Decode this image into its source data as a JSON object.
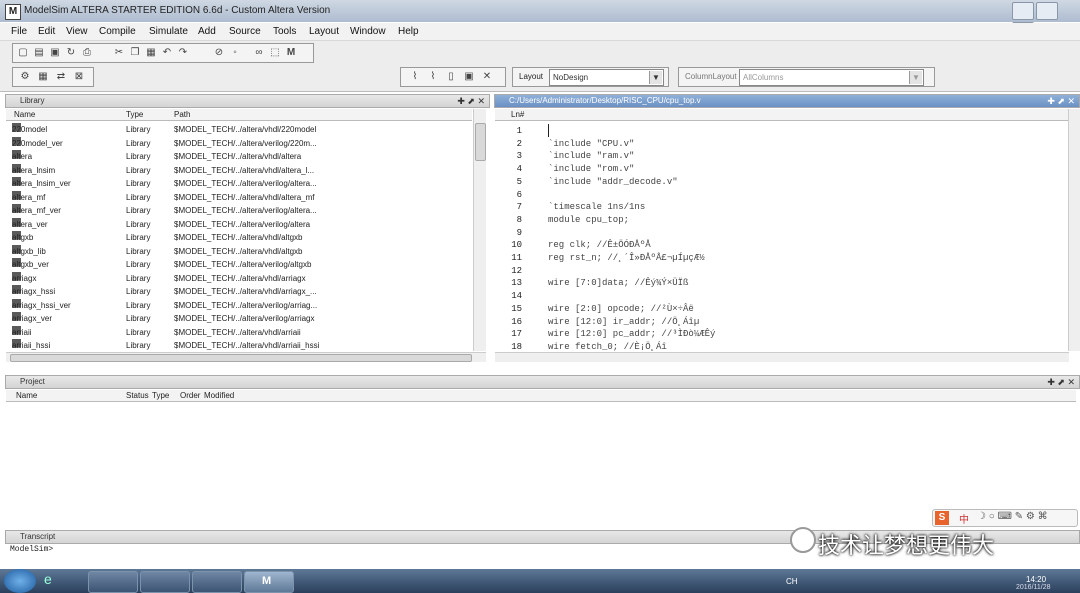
{
  "window": {
    "title": "ModelSim ALTERA STARTER EDITION 6.6d - Custom Altera Version",
    "icon": "M"
  },
  "menu": [
    "File",
    "Edit",
    "View",
    "Compile",
    "Simulate",
    "Add",
    "Source",
    "Tools",
    "Layout",
    "Window",
    "Help"
  ],
  "toolbar": {
    "layout_label": "Layout",
    "layout_value": "NoDesign",
    "column_layout_label": "ColumnLayout",
    "column_layout_value": "AllColumns"
  },
  "library_pane": {
    "title": "Library",
    "columns": [
      "Name",
      "Type",
      "Path"
    ],
    "rows": [
      {
        "name": "220model",
        "type": "Library",
        "path": "$MODEL_TECH/../altera/vhdl/220model"
      },
      {
        "name": "220model_ver",
        "type": "Library",
        "path": "$MODEL_TECH/../altera/verilog/220m..."
      },
      {
        "name": "altera",
        "type": "Library",
        "path": "$MODEL_TECH/../altera/vhdl/altera"
      },
      {
        "name": "altera_lnsim",
        "type": "Library",
        "path": "$MODEL_TECH/../altera/vhdl/altera_l..."
      },
      {
        "name": "altera_lnsim_ver",
        "type": "Library",
        "path": "$MODEL_TECH/../altera/verilog/altera..."
      },
      {
        "name": "altera_mf",
        "type": "Library",
        "path": "$MODEL_TECH/../altera/vhdl/altera_mf"
      },
      {
        "name": "altera_mf_ver",
        "type": "Library",
        "path": "$MODEL_TECH/../altera/verilog/altera..."
      },
      {
        "name": "altera_ver",
        "type": "Library",
        "path": "$MODEL_TECH/../altera/verilog/altera"
      },
      {
        "name": "altgxb",
        "type": "Library",
        "path": "$MODEL_TECH/../altera/vhdl/altgxb"
      },
      {
        "name": "altgxb_lib",
        "type": "Library",
        "path": "$MODEL_TECH/../altera/vhdl/altgxb"
      },
      {
        "name": "altgxb_ver",
        "type": "Library",
        "path": "$MODEL_TECH/../altera/verilog/altgxb"
      },
      {
        "name": "arriagx",
        "type": "Library",
        "path": "$MODEL_TECH/../altera/vhdl/arriagx"
      },
      {
        "name": "arriagx_hssi",
        "type": "Library",
        "path": "$MODEL_TECH/../altera/vhdl/arriagx_..."
      },
      {
        "name": "arriagx_hssi_ver",
        "type": "Library",
        "path": "$MODEL_TECH/../altera/verilog/arriag..."
      },
      {
        "name": "arriagx_ver",
        "type": "Library",
        "path": "$MODEL_TECH/../altera/verilog/arriagx"
      },
      {
        "name": "arriaii",
        "type": "Library",
        "path": "$MODEL_TECH/../altera/vhdl/arriaii"
      },
      {
        "name": "arriaii_hssi",
        "type": "Library",
        "path": "$MODEL_TECH/../altera/vhdl/arriaii_hssi"
      }
    ]
  },
  "editor": {
    "path": "C:/Users/Administrator/Desktop/RISC_CPU/cpu_top.v",
    "column_header": "Ln#",
    "lines": [
      {
        "n": "1",
        "code": ""
      },
      {
        "n": "2",
        "code": "`include \"CPU.v\""
      },
      {
        "n": "3",
        "code": "`include \"ram.v\""
      },
      {
        "n": "4",
        "code": "`include \"rom.v\""
      },
      {
        "n": "5",
        "code": "`include \"addr_decode.v\""
      },
      {
        "n": "6",
        "code": ""
      },
      {
        "n": "7",
        "code": "`timescale 1ns/1ns"
      },
      {
        "n": "8",
        "code": "module cpu_top;"
      },
      {
        "n": "9",
        "code": ""
      },
      {
        "n": "10",
        "code": "reg clk;   //Ê±ÖÓÐÅºÅ"
      },
      {
        "n": "11",
        "code": "reg rst_n; //¸´Î»ÐÅºÅ£¬µÍµçÆ½"
      },
      {
        "n": "12",
        "code": ""
      },
      {
        "n": "13",
        "code": "wire [7:0]data; //Êý¾Ý×ÜÏß"
      },
      {
        "n": "14",
        "code": ""
      },
      {
        "n": "15",
        "code": "wire [2:0] opcode;   //²Ù×÷Âë"
      },
      {
        "n": "16",
        "code": "wire [12:0] ir_addr;   //Ö¸Áîµ"
      },
      {
        "n": "17",
        "code": "wire [12:0] pc_addr;   //³ÌÐò¼ÆÊý"
      },
      {
        "n": "18",
        "code": "wire fetch_0;         //È¡Ö¸Áî"
      }
    ]
  },
  "project_pane": {
    "title": "Project",
    "columns": [
      "Name",
      "Status",
      "Type",
      "Order",
      "Modified"
    ]
  },
  "transcript": {
    "title": "Transcript",
    "prompt": "ModelSim>"
  },
  "watermark": "技术让梦想更伟大",
  "clock": {
    "time": "14:20",
    "date": "2016/11/28"
  },
  "tray": [
    "CH",
    "中"
  ]
}
